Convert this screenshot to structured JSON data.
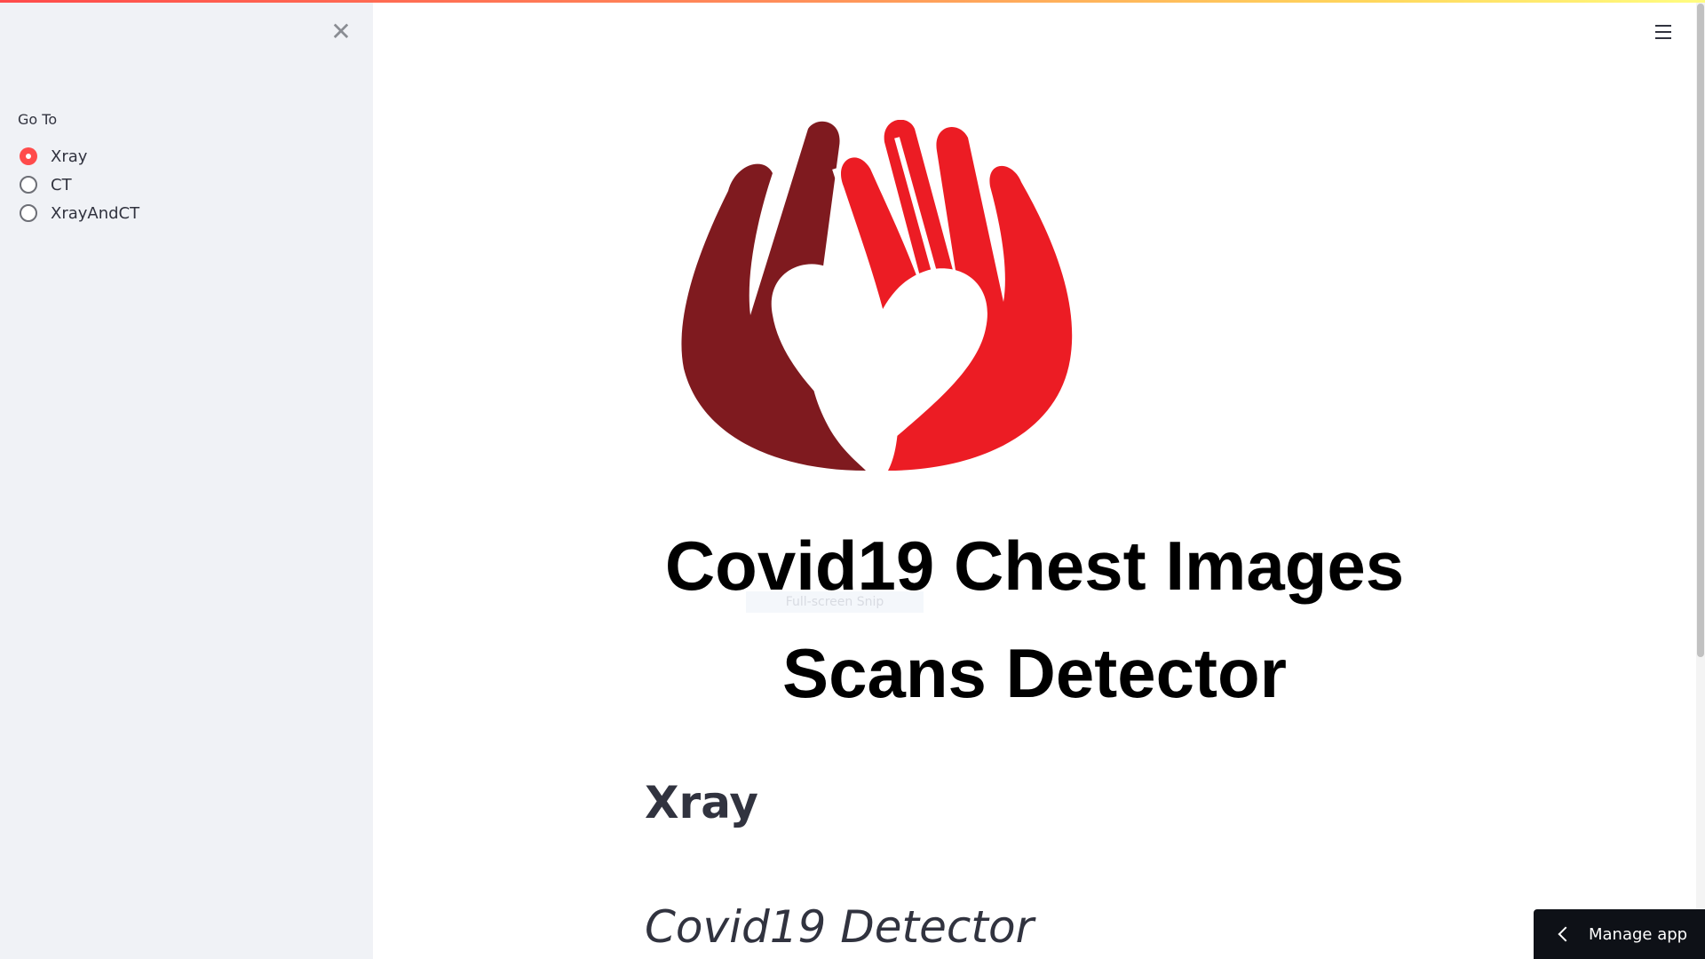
{
  "sidebar": {
    "close_icon": "close-icon",
    "radio_group_label": "Go To",
    "options": [
      {
        "label": "Xray",
        "selected": true
      },
      {
        "label": "CT",
        "selected": false
      },
      {
        "label": "XrayAndCT",
        "selected": false
      }
    ]
  },
  "header": {
    "menu_icon": "hamburger-menu-icon"
  },
  "main": {
    "logo": {
      "icon": "hands-heart-logo",
      "colors": {
        "left_hand": "#7f1a1f",
        "right_hand": "#ec1c24",
        "heart": "#ffffff"
      }
    },
    "title_line1": "Covid19 Chest Images",
    "title_line2": "Scans Detector",
    "section_heading": "Xray",
    "sub_heading": "Covid19 Detector",
    "overlay_text": "Full-screen Snip"
  },
  "footer": {
    "manage_app_label": "Manage app",
    "manage_app_icon": "chevron-left-icon"
  },
  "theme": {
    "accent": "#ff4b4b",
    "sidebar_bg": "#f0f2f6",
    "text": "#31333f",
    "footer_bg": "#0e1117"
  }
}
